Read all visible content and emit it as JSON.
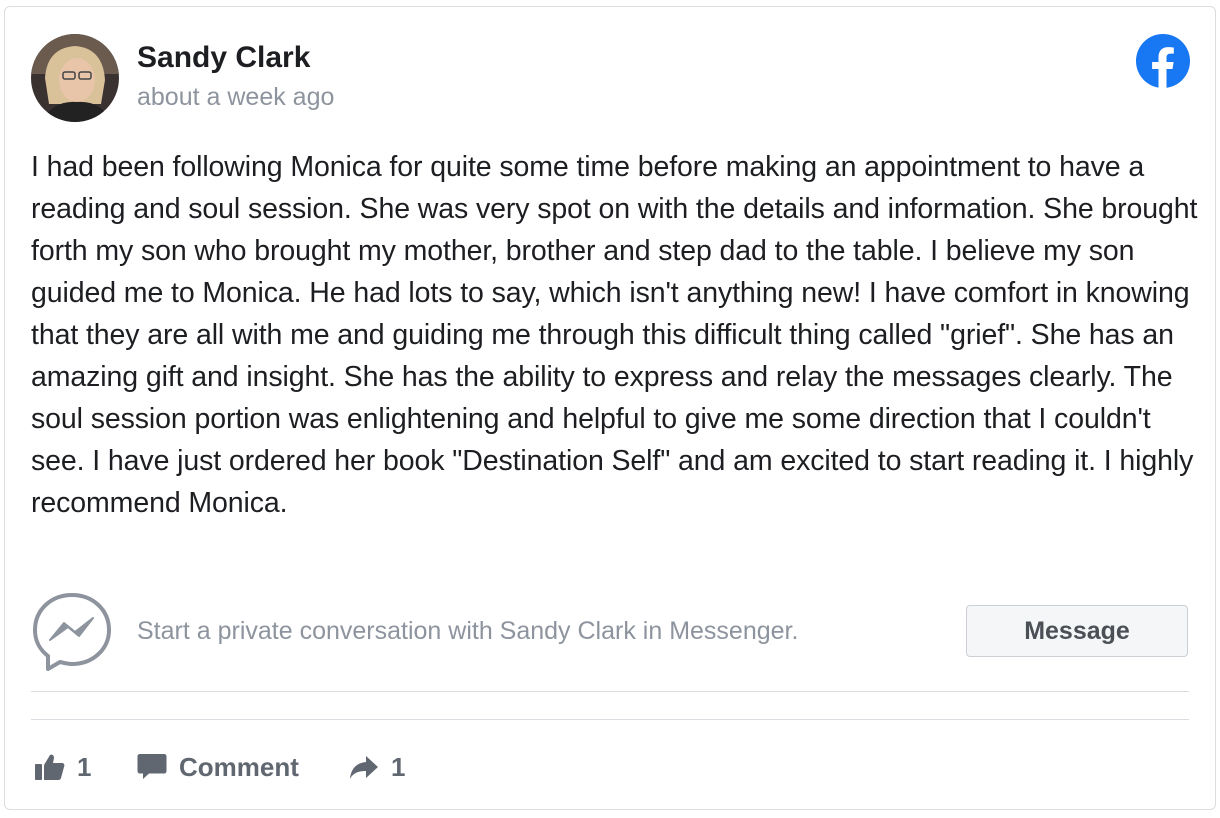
{
  "post": {
    "author": "Sandy Clark",
    "timestamp": "about a week ago",
    "body": "I had been following Monica for quite some time before making an appointment to have a reading and soul session. She was very spot on with the details and information. She brought forth my son who brought my mother, brother and step dad to the table. I believe my son guided me to Monica. He had lots to say, which isn't anything new! I have comfort in knowing that they are all with me and guiding me through this difficult thing called \"grief\". She has an amazing gift and insight. She has the ability to express and relay the messages clearly. The soul session portion was enlightening and helpful to give me some direction that I couldn't see. I have just ordered her book \"Destination Self\" and am excited to start reading it. I highly recommend Monica."
  },
  "messenger": {
    "prompt": "Start a private conversation with Sandy Clark in Messenger.",
    "button_label": "Message"
  },
  "actions": {
    "like_count": "1",
    "comment_label": "Comment",
    "share_count": "1"
  },
  "icons": {
    "brand": "facebook-icon",
    "messenger": "messenger-icon",
    "like": "thumbs-up-icon",
    "comment": "comment-bubble-icon",
    "share": "share-arrow-icon"
  },
  "colors": {
    "facebook_blue": "#1877f2",
    "text_primary": "#1c1e21",
    "text_secondary": "#8d949e",
    "action_gray": "#606770"
  }
}
